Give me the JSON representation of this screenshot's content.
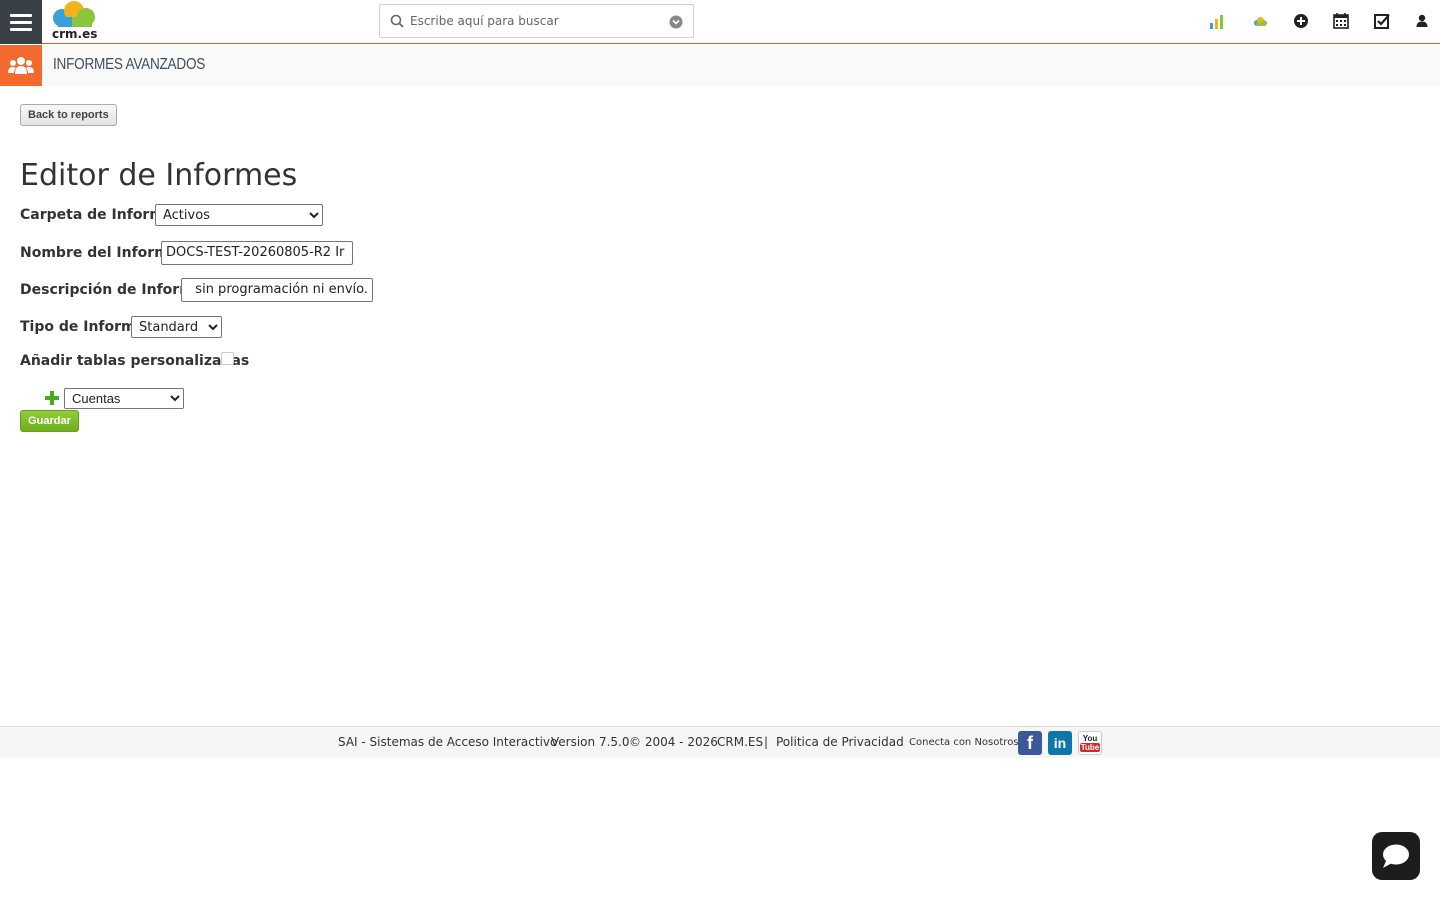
{
  "header": {
    "logo_text": "crm.es",
    "search": {
      "placeholder": "Escribe aquí para buscar"
    },
    "colors": {
      "accent": "#e8541f",
      "dark": "#3a4047"
    },
    "icons": [
      "bar-chart-icon",
      "cloud-icon",
      "plus-circle-icon",
      "calendar-icon",
      "checkbox-icon",
      "user-icon"
    ]
  },
  "module": {
    "title": "Informes Avanzados",
    "icon": "users-icon",
    "color": "#f26a2e"
  },
  "content": {
    "back_label": "Back to reports",
    "title": "Editor de Informes",
    "fields": {
      "folder": {
        "label": "Carpeta de Informe",
        "value": "Activos"
      },
      "name": {
        "label": "Nombre del Informe",
        "value": "DOCS-TEST-20260805-R2 Ir"
      },
      "description": {
        "label": "Descripción de Informe",
        "value": " sin programación ni envío."
      },
      "type": {
        "label": "Tipo de Informe",
        "value": "Standard"
      },
      "custom_tables": {
        "label": "Añadir tablas personalizadas"
      },
      "module": {
        "value": "Cuentas"
      }
    },
    "save_label": "Guardar"
  },
  "footer": {
    "company": "SAI - Sistemas de Acceso Interactivo",
    "version": "Version 7.5.0",
    "copyright": "© 2004 - 2026",
    "brand": "CRM.ES",
    "separator": "|",
    "privacy": "Politica de Privacidad",
    "connect": "Conecta con Nosotros",
    "social": [
      "facebook-icon",
      "linkedin-icon",
      "youtube-icon"
    ],
    "youtube_you": "You",
    "youtube_tube": "Tube"
  }
}
